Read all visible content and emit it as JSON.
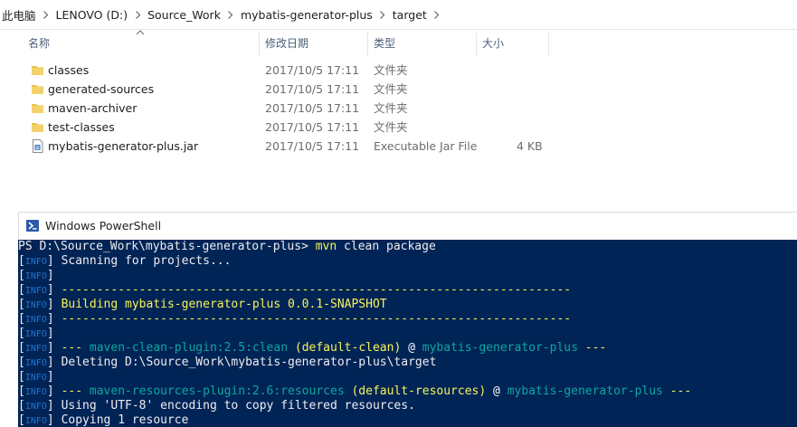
{
  "address": {
    "crumbs": [
      "此电脑",
      "LENOVO (D:)",
      "Source_Work",
      "mybatis-generator-plus",
      "target"
    ]
  },
  "columns": {
    "name": "名称",
    "date": "修改日期",
    "type": "类型",
    "size": "大小"
  },
  "files": [
    {
      "name": "classes",
      "date": "2017/10/5 17:11",
      "type": "文件夹",
      "size": "",
      "icon": "folder-icon"
    },
    {
      "name": "generated-sources",
      "date": "2017/10/5 17:11",
      "type": "文件夹",
      "size": "",
      "icon": "folder-icon"
    },
    {
      "name": "maven-archiver",
      "date": "2017/10/5 17:11",
      "type": "文件夹",
      "size": "",
      "icon": "folder-icon"
    },
    {
      "name": "test-classes",
      "date": "2017/10/5 17:11",
      "type": "文件夹",
      "size": "",
      "icon": "folder-icon"
    },
    {
      "name": "mybatis-generator-plus.jar",
      "date": "2017/10/5 17:11",
      "type": "Executable Jar File",
      "size": "4 KB",
      "icon": "jar-file-icon"
    }
  ],
  "powershell": {
    "title": "Windows PowerShell",
    "prompt": "PS D:\\Source_Work\\mybatis-generator-plus> ",
    "command_exe": "mvn",
    "command_args": " clean package",
    "info_tag": "INFO",
    "lines": [
      {
        "parts": [
          {
            "t": "Scanning for projects...",
            "c": ""
          }
        ]
      },
      {
        "parts": []
      },
      {
        "parts": [
          {
            "t": "------------------------------------------------------------------------",
            "c": "yel"
          }
        ]
      },
      {
        "parts": [
          {
            "t": "Building mybatis-generator-plus 0.0.1-SNAPSHOT",
            "c": "yel"
          }
        ]
      },
      {
        "parts": [
          {
            "t": "------------------------------------------------------------------------",
            "c": "yel"
          }
        ]
      },
      {
        "parts": []
      },
      {
        "parts": [
          {
            "t": "--- ",
            "c": "yel"
          },
          {
            "t": "maven-clean-plugin:2.5:clean",
            "c": "tea"
          },
          {
            "t": " (default-clean)",
            "c": "yel"
          },
          {
            "t": " @ ",
            "c": "mag"
          },
          {
            "t": "mybatis-generator-plus",
            "c": "tea"
          },
          {
            "t": " ---",
            "c": "yel"
          }
        ]
      },
      {
        "parts": [
          {
            "t": "Deleting D:\\Source_Work\\mybatis-generator-plus\\target",
            "c": ""
          }
        ]
      },
      {
        "parts": []
      },
      {
        "parts": [
          {
            "t": "--- ",
            "c": "yel"
          },
          {
            "t": "maven-resources-plugin:2.6:resources",
            "c": "tea"
          },
          {
            "t": " (default-resources)",
            "c": "yel"
          },
          {
            "t": " @ ",
            "c": "mag"
          },
          {
            "t": "mybatis-generator-plus",
            "c": "tea"
          },
          {
            "t": " ---",
            "c": "yel"
          }
        ]
      },
      {
        "parts": [
          {
            "t": "Using 'UTF-8' encoding to copy filtered resources.",
            "c": ""
          }
        ]
      },
      {
        "parts": [
          {
            "t": "Copying 1 resource",
            "c": ""
          }
        ]
      }
    ]
  },
  "colors": {
    "console_bg": "#012456",
    "console_fg": "#eeedf0",
    "yellow": "#f7f35a",
    "teal": "#0ea69f",
    "info_blue": "#1e74d4",
    "folder": "#e8c14e"
  }
}
